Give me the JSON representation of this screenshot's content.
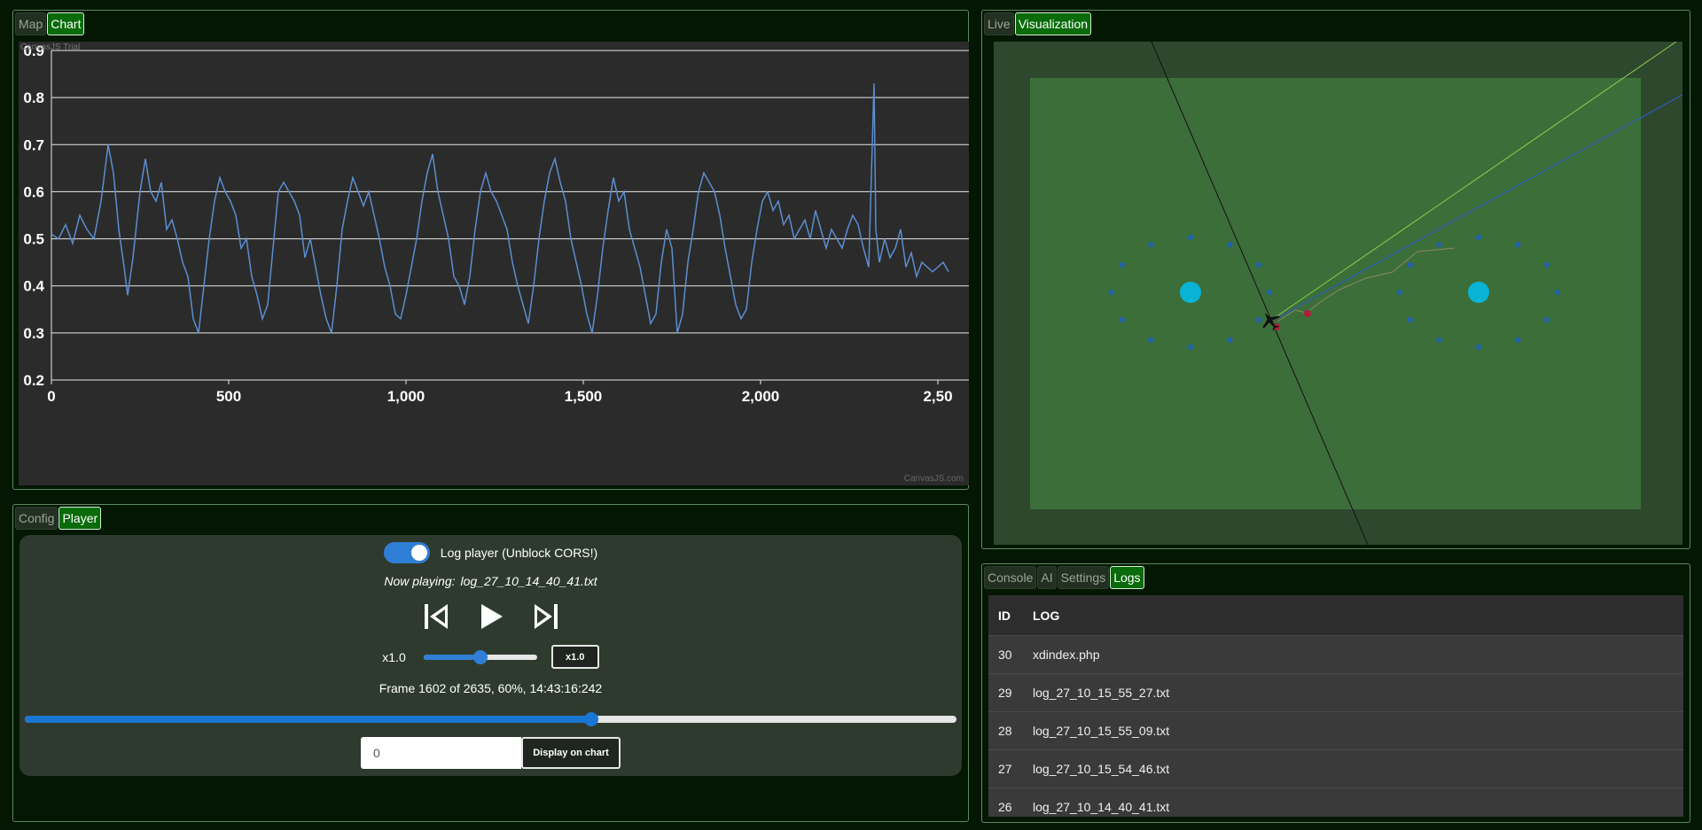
{
  "chart_panel": {
    "tabs": [
      {
        "label": "Map",
        "active": false
      },
      {
        "label": "Chart",
        "active": true
      }
    ],
    "trial_text": "CanvasJS Trial",
    "credit_text": "CanvasJS.com"
  },
  "chart_data": {
    "type": "line",
    "title": "",
    "xlabel": "",
    "ylabel": "",
    "xlim": [
      0,
      2530
    ],
    "ylim": [
      0.2,
      0.9
    ],
    "x_ticks": [
      "0",
      "500",
      "1,000",
      "1,500",
      "2,000",
      "2,50"
    ],
    "y_ticks": [
      "0.9",
      "0.8",
      "0.7",
      "0.6",
      "0.5",
      "0.4",
      "0.3",
      "0.2"
    ],
    "grid": true,
    "series": [
      {
        "color": "#5b8ed1",
        "points": [
          [
            0,
            0.51
          ],
          [
            20,
            0.5
          ],
          [
            40,
            0.53
          ],
          [
            60,
            0.49
          ],
          [
            80,
            0.55
          ],
          [
            100,
            0.52
          ],
          [
            120,
            0.5
          ],
          [
            140,
            0.58
          ],
          [
            160,
            0.7
          ],
          [
            175,
            0.64
          ],
          [
            190,
            0.52
          ],
          [
            205,
            0.44
          ],
          [
            215,
            0.38
          ],
          [
            230,
            0.46
          ],
          [
            250,
            0.6
          ],
          [
            265,
            0.67
          ],
          [
            280,
            0.6
          ],
          [
            295,
            0.58
          ],
          [
            310,
            0.62
          ],
          [
            325,
            0.52
          ],
          [
            340,
            0.54
          ],
          [
            355,
            0.5
          ],
          [
            370,
            0.45
          ],
          [
            385,
            0.42
          ],
          [
            400,
            0.33
          ],
          [
            415,
            0.3
          ],
          [
            430,
            0.4
          ],
          [
            445,
            0.5
          ],
          [
            460,
            0.58
          ],
          [
            475,
            0.63
          ],
          [
            490,
            0.6
          ],
          [
            505,
            0.58
          ],
          [
            520,
            0.55
          ],
          [
            535,
            0.48
          ],
          [
            550,
            0.5
          ],
          [
            565,
            0.42
          ],
          [
            580,
            0.38
          ],
          [
            595,
            0.33
          ],
          [
            610,
            0.36
          ],
          [
            625,
            0.48
          ],
          [
            640,
            0.6
          ],
          [
            655,
            0.62
          ],
          [
            670,
            0.6
          ],
          [
            685,
            0.58
          ],
          [
            700,
            0.55
          ],
          [
            715,
            0.46
          ],
          [
            730,
            0.5
          ],
          [
            745,
            0.44
          ],
          [
            760,
            0.38
          ],
          [
            775,
            0.33
          ],
          [
            790,
            0.3
          ],
          [
            805,
            0.4
          ],
          [
            820,
            0.52
          ],
          [
            835,
            0.58
          ],
          [
            850,
            0.63
          ],
          [
            865,
            0.6
          ],
          [
            880,
            0.57
          ],
          [
            895,
            0.6
          ],
          [
            910,
            0.55
          ],
          [
            925,
            0.5
          ],
          [
            940,
            0.44
          ],
          [
            955,
            0.4
          ],
          [
            970,
            0.34
          ],
          [
            985,
            0.33
          ],
          [
            1000,
            0.38
          ],
          [
            1015,
            0.44
          ],
          [
            1030,
            0.5
          ],
          [
            1045,
            0.58
          ],
          [
            1060,
            0.64
          ],
          [
            1075,
            0.68
          ],
          [
            1090,
            0.6
          ],
          [
            1105,
            0.55
          ],
          [
            1120,
            0.5
          ],
          [
            1135,
            0.42
          ],
          [
            1150,
            0.4
          ],
          [
            1165,
            0.36
          ],
          [
            1180,
            0.42
          ],
          [
            1195,
            0.52
          ],
          [
            1210,
            0.6
          ],
          [
            1225,
            0.64
          ],
          [
            1240,
            0.6
          ],
          [
            1255,
            0.58
          ],
          [
            1270,
            0.55
          ],
          [
            1285,
            0.52
          ],
          [
            1300,
            0.45
          ],
          [
            1315,
            0.4
          ],
          [
            1330,
            0.36
          ],
          [
            1345,
            0.32
          ],
          [
            1360,
            0.4
          ],
          [
            1375,
            0.5
          ],
          [
            1390,
            0.58
          ],
          [
            1405,
            0.64
          ],
          [
            1420,
            0.67
          ],
          [
            1435,
            0.62
          ],
          [
            1450,
            0.58
          ],
          [
            1465,
            0.5
          ],
          [
            1480,
            0.45
          ],
          [
            1495,
            0.4
          ],
          [
            1510,
            0.34
          ],
          [
            1525,
            0.3
          ],
          [
            1540,
            0.38
          ],
          [
            1555,
            0.48
          ],
          [
            1570,
            0.56
          ],
          [
            1585,
            0.63
          ],
          [
            1600,
            0.58
          ],
          [
            1615,
            0.6
          ],
          [
            1630,
            0.52
          ],
          [
            1645,
            0.48
          ],
          [
            1660,
            0.44
          ],
          [
            1675,
            0.38
          ],
          [
            1690,
            0.32
          ],
          [
            1705,
            0.34
          ],
          [
            1720,
            0.45
          ],
          [
            1735,
            0.52
          ],
          [
            1750,
            0.48
          ],
          [
            1765,
            0.3
          ],
          [
            1780,
            0.34
          ],
          [
            1795,
            0.45
          ],
          [
            1810,
            0.52
          ],
          [
            1825,
            0.6
          ],
          [
            1840,
            0.64
          ],
          [
            1855,
            0.62
          ],
          [
            1870,
            0.6
          ],
          [
            1885,
            0.55
          ],
          [
            1900,
            0.48
          ],
          [
            1915,
            0.42
          ],
          [
            1930,
            0.36
          ],
          [
            1945,
            0.33
          ],
          [
            1960,
            0.35
          ],
          [
            1975,
            0.45
          ],
          [
            1990,
            0.52
          ],
          [
            2005,
            0.58
          ],
          [
            2020,
            0.6
          ],
          [
            2035,
            0.56
          ],
          [
            2050,
            0.58
          ],
          [
            2065,
            0.53
          ],
          [
            2080,
            0.55
          ],
          [
            2095,
            0.5
          ],
          [
            2110,
            0.52
          ],
          [
            2125,
            0.54
          ],
          [
            2140,
            0.5
          ],
          [
            2155,
            0.56
          ],
          [
            2170,
            0.52
          ],
          [
            2185,
            0.48
          ],
          [
            2200,
            0.52
          ],
          [
            2215,
            0.5
          ],
          [
            2230,
            0.48
          ],
          [
            2245,
            0.52
          ],
          [
            2260,
            0.55
          ],
          [
            2275,
            0.53
          ],
          [
            2290,
            0.48
          ],
          [
            2305,
            0.44
          ],
          [
            2320,
            0.83
          ],
          [
            2325,
            0.52
          ],
          [
            2335,
            0.45
          ],
          [
            2350,
            0.5
          ],
          [
            2365,
            0.46
          ],
          [
            2380,
            0.48
          ],
          [
            2395,
            0.52
          ],
          [
            2410,
            0.44
          ],
          [
            2425,
            0.47
          ],
          [
            2440,
            0.42
          ],
          [
            2455,
            0.45
          ],
          [
            2470,
            0.44
          ],
          [
            2485,
            0.43
          ],
          [
            2500,
            0.44
          ],
          [
            2515,
            0.45
          ],
          [
            2530,
            0.43
          ]
        ]
      }
    ]
  },
  "player_panel": {
    "tabs": [
      {
        "label": "Config",
        "active": false
      },
      {
        "label": "Player",
        "active": true
      }
    ],
    "toggle_label": "Log player (Unblock CORS!)",
    "now_playing_label": "Now playing:",
    "now_playing_file": "log_27_10_14_40_41.txt",
    "speed_label": "x1.0",
    "speed_button": "x1.0",
    "speed_fraction": 0.5,
    "frame_text": "Frame 1602 of 2635, 60%, 14:43:16:242",
    "frame_progress": 0.608,
    "input_value": "0",
    "display_button": "Display on chart"
  },
  "viz_panel": {
    "tabs": [
      {
        "label": "Live",
        "active": false
      },
      {
        "label": "Visualization",
        "active": true
      }
    ],
    "colors": {
      "outer": "#2e482e",
      "field": "#3c6e3a",
      "marker": "#2262a8",
      "pylon": "#08b3d6",
      "target": "#b01c3c"
    }
  },
  "logs_panel": {
    "tabs": [
      {
        "label": "Console",
        "active": false
      },
      {
        "label": "AI",
        "active": false
      },
      {
        "label": "Settings",
        "active": false
      },
      {
        "label": "Logs",
        "active": true
      }
    ],
    "headers": {
      "id": "ID",
      "log": "LOG"
    },
    "rows": [
      {
        "id": "30",
        "log": "xdindex.php"
      },
      {
        "id": "29",
        "log": "log_27_10_15_55_27.txt"
      },
      {
        "id": "28",
        "log": "log_27_10_15_55_09.txt"
      },
      {
        "id": "27",
        "log": "log_27_10_15_54_46.txt"
      },
      {
        "id": "26",
        "log": "log_27_10_14_40_41.txt"
      }
    ]
  }
}
